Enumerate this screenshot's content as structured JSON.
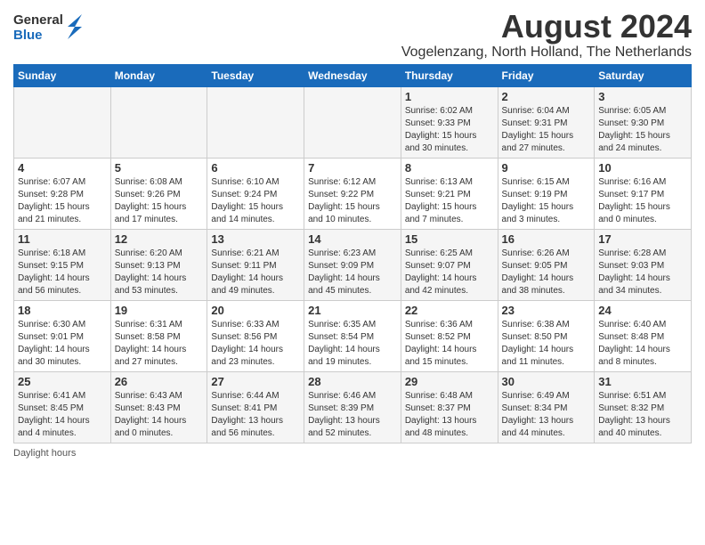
{
  "logo": {
    "general": "General",
    "blue": "Blue"
  },
  "title": "August 2024",
  "location": "Vogelenzang, North Holland, The Netherlands",
  "days_of_week": [
    "Sunday",
    "Monday",
    "Tuesday",
    "Wednesday",
    "Thursday",
    "Friday",
    "Saturday"
  ],
  "footer": "Daylight hours",
  "weeks": [
    [
      {
        "day": "",
        "sunrise": "",
        "sunset": "",
        "daylight": ""
      },
      {
        "day": "",
        "sunrise": "",
        "sunset": "",
        "daylight": ""
      },
      {
        "day": "",
        "sunrise": "",
        "sunset": "",
        "daylight": ""
      },
      {
        "day": "",
        "sunrise": "",
        "sunset": "",
        "daylight": ""
      },
      {
        "day": "1",
        "sunrise": "Sunrise: 6:02 AM",
        "sunset": "Sunset: 9:33 PM",
        "daylight": "Daylight: 15 hours and 30 minutes."
      },
      {
        "day": "2",
        "sunrise": "Sunrise: 6:04 AM",
        "sunset": "Sunset: 9:31 PM",
        "daylight": "Daylight: 15 hours and 27 minutes."
      },
      {
        "day": "3",
        "sunrise": "Sunrise: 6:05 AM",
        "sunset": "Sunset: 9:30 PM",
        "daylight": "Daylight: 15 hours and 24 minutes."
      }
    ],
    [
      {
        "day": "4",
        "sunrise": "Sunrise: 6:07 AM",
        "sunset": "Sunset: 9:28 PM",
        "daylight": "Daylight: 15 hours and 21 minutes."
      },
      {
        "day": "5",
        "sunrise": "Sunrise: 6:08 AM",
        "sunset": "Sunset: 9:26 PM",
        "daylight": "Daylight: 15 hours and 17 minutes."
      },
      {
        "day": "6",
        "sunrise": "Sunrise: 6:10 AM",
        "sunset": "Sunset: 9:24 PM",
        "daylight": "Daylight: 15 hours and 14 minutes."
      },
      {
        "day": "7",
        "sunrise": "Sunrise: 6:12 AM",
        "sunset": "Sunset: 9:22 PM",
        "daylight": "Daylight: 15 hours and 10 minutes."
      },
      {
        "day": "8",
        "sunrise": "Sunrise: 6:13 AM",
        "sunset": "Sunset: 9:21 PM",
        "daylight": "Daylight: 15 hours and 7 minutes."
      },
      {
        "day": "9",
        "sunrise": "Sunrise: 6:15 AM",
        "sunset": "Sunset: 9:19 PM",
        "daylight": "Daylight: 15 hours and 3 minutes."
      },
      {
        "day": "10",
        "sunrise": "Sunrise: 6:16 AM",
        "sunset": "Sunset: 9:17 PM",
        "daylight": "Daylight: 15 hours and 0 minutes."
      }
    ],
    [
      {
        "day": "11",
        "sunrise": "Sunrise: 6:18 AM",
        "sunset": "Sunset: 9:15 PM",
        "daylight": "Daylight: 14 hours and 56 minutes."
      },
      {
        "day": "12",
        "sunrise": "Sunrise: 6:20 AM",
        "sunset": "Sunset: 9:13 PM",
        "daylight": "Daylight: 14 hours and 53 minutes."
      },
      {
        "day": "13",
        "sunrise": "Sunrise: 6:21 AM",
        "sunset": "Sunset: 9:11 PM",
        "daylight": "Daylight: 14 hours and 49 minutes."
      },
      {
        "day": "14",
        "sunrise": "Sunrise: 6:23 AM",
        "sunset": "Sunset: 9:09 PM",
        "daylight": "Daylight: 14 hours and 45 minutes."
      },
      {
        "day": "15",
        "sunrise": "Sunrise: 6:25 AM",
        "sunset": "Sunset: 9:07 PM",
        "daylight": "Daylight: 14 hours and 42 minutes."
      },
      {
        "day": "16",
        "sunrise": "Sunrise: 6:26 AM",
        "sunset": "Sunset: 9:05 PM",
        "daylight": "Daylight: 14 hours and 38 minutes."
      },
      {
        "day": "17",
        "sunrise": "Sunrise: 6:28 AM",
        "sunset": "Sunset: 9:03 PM",
        "daylight": "Daylight: 14 hours and 34 minutes."
      }
    ],
    [
      {
        "day": "18",
        "sunrise": "Sunrise: 6:30 AM",
        "sunset": "Sunset: 9:01 PM",
        "daylight": "Daylight: 14 hours and 30 minutes."
      },
      {
        "day": "19",
        "sunrise": "Sunrise: 6:31 AM",
        "sunset": "Sunset: 8:58 PM",
        "daylight": "Daylight: 14 hours and 27 minutes."
      },
      {
        "day": "20",
        "sunrise": "Sunrise: 6:33 AM",
        "sunset": "Sunset: 8:56 PM",
        "daylight": "Daylight: 14 hours and 23 minutes."
      },
      {
        "day": "21",
        "sunrise": "Sunrise: 6:35 AM",
        "sunset": "Sunset: 8:54 PM",
        "daylight": "Daylight: 14 hours and 19 minutes."
      },
      {
        "day": "22",
        "sunrise": "Sunrise: 6:36 AM",
        "sunset": "Sunset: 8:52 PM",
        "daylight": "Daylight: 14 hours and 15 minutes."
      },
      {
        "day": "23",
        "sunrise": "Sunrise: 6:38 AM",
        "sunset": "Sunset: 8:50 PM",
        "daylight": "Daylight: 14 hours and 11 minutes."
      },
      {
        "day": "24",
        "sunrise": "Sunrise: 6:40 AM",
        "sunset": "Sunset: 8:48 PM",
        "daylight": "Daylight: 14 hours and 8 minutes."
      }
    ],
    [
      {
        "day": "25",
        "sunrise": "Sunrise: 6:41 AM",
        "sunset": "Sunset: 8:45 PM",
        "daylight": "Daylight: 14 hours and 4 minutes."
      },
      {
        "day": "26",
        "sunrise": "Sunrise: 6:43 AM",
        "sunset": "Sunset: 8:43 PM",
        "daylight": "Daylight: 14 hours and 0 minutes."
      },
      {
        "day": "27",
        "sunrise": "Sunrise: 6:44 AM",
        "sunset": "Sunset: 8:41 PM",
        "daylight": "Daylight: 13 hours and 56 minutes."
      },
      {
        "day": "28",
        "sunrise": "Sunrise: 6:46 AM",
        "sunset": "Sunset: 8:39 PM",
        "daylight": "Daylight: 13 hours and 52 minutes."
      },
      {
        "day": "29",
        "sunrise": "Sunrise: 6:48 AM",
        "sunset": "Sunset: 8:37 PM",
        "daylight": "Daylight: 13 hours and 48 minutes."
      },
      {
        "day": "30",
        "sunrise": "Sunrise: 6:49 AM",
        "sunset": "Sunset: 8:34 PM",
        "daylight": "Daylight: 13 hours and 44 minutes."
      },
      {
        "day": "31",
        "sunrise": "Sunrise: 6:51 AM",
        "sunset": "Sunset: 8:32 PM",
        "daylight": "Daylight: 13 hours and 40 minutes."
      }
    ]
  ]
}
